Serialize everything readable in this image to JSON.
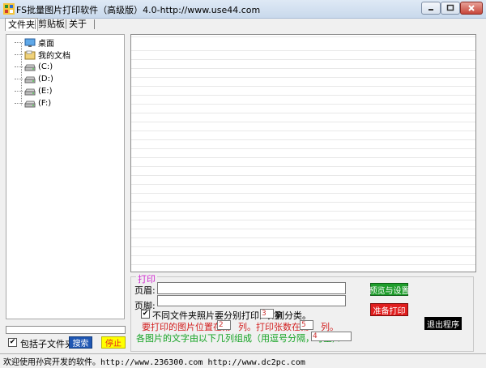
{
  "window": {
    "title": "FS批量图片打印软件（高级版）4.0-http://www.use44.com",
    "icons": {
      "app": "app-icon",
      "minimize": "minimize-icon",
      "maximize": "maximize-icon",
      "close": "close-icon"
    }
  },
  "tabs": [
    {
      "label": "文件夹",
      "active": true
    },
    {
      "label": "剪贴板",
      "active": false
    },
    {
      "label": "关于",
      "active": false
    }
  ],
  "tree": {
    "items": [
      {
        "label": "桌面",
        "icon": "desktop-icon"
      },
      {
        "label": "我的文档",
        "icon": "documents-icon"
      },
      {
        "label": "(C:)",
        "icon": "drive-icon"
      },
      {
        "label": "(D:)",
        "icon": "drive-icon"
      },
      {
        "label": "(E:)",
        "icon": "drive-icon"
      },
      {
        "label": "(F:)",
        "icon": "drive-icon"
      }
    ]
  },
  "left_controls": {
    "include_subfolders_label": "包括子文件夹",
    "include_subfolders_checked": true,
    "search_label": "搜索",
    "stop_label": "停止"
  },
  "print": {
    "legend": "打印",
    "header_label": "页眉:",
    "header_value": "",
    "footer_label": "页脚:",
    "footer_value": "",
    "separate_folders_checked": true,
    "separate_text_before": "不同文件夹照片要分别打印, 以第",
    "separate_column_value": "3",
    "separate_text_after": "列分类。",
    "position_text_before": "要打印的图片位置在第",
    "position_column_value": "2",
    "position_text_mid": "列。打印张数在第",
    "count_column_value": "5",
    "position_text_after": "列。",
    "caption_text": "各图片的文字由以下几列组成（用逗号分隔，可空）：",
    "caption_columns_value": "4",
    "preview_settings_label": "预览与设置",
    "prepare_print_label": "准备打印",
    "exit_label": "退出程序"
  },
  "status": {
    "text": "欢迎使用孙宾开发的软件。http://www.236300.com http://www.dc2pc.com"
  },
  "colors": {
    "legend": "#d02ad0",
    "red_text": "#d21f1f",
    "green_text": "#15a324",
    "preview_button": "#1f9d2c",
    "print_button": "#e01e1e",
    "search_button": "#1f57b3",
    "stop_button": "#ffff00"
  }
}
